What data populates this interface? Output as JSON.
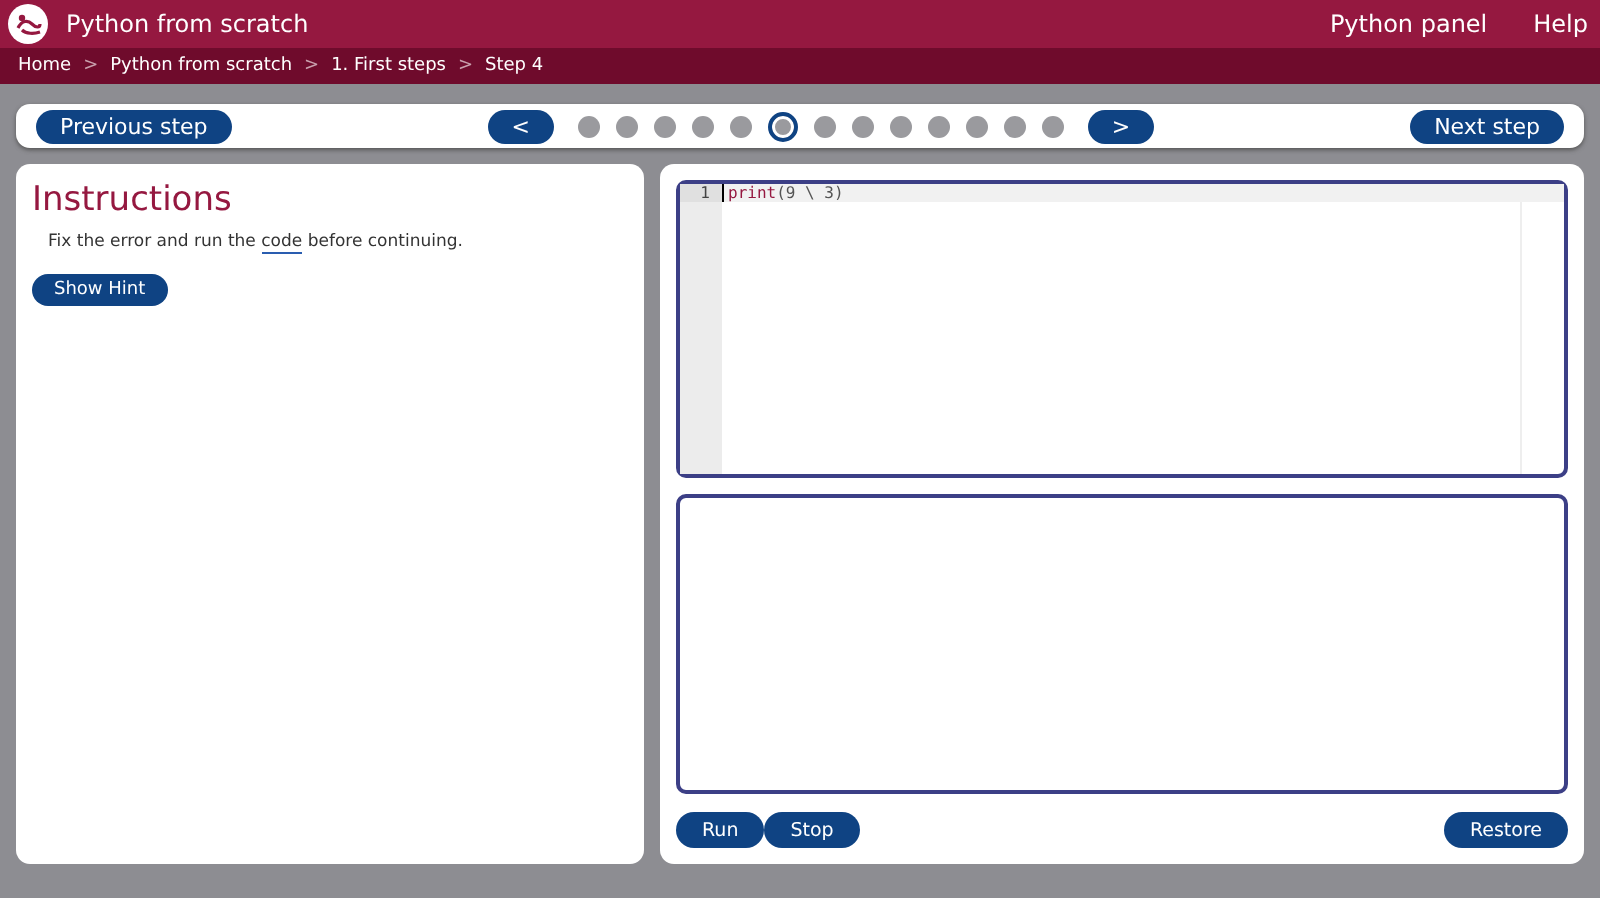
{
  "header": {
    "title": "Python from scratch",
    "menu": [
      "Python panel",
      "Help"
    ]
  },
  "breadcrumbs": [
    "Home",
    "Python from scratch",
    "1. First steps",
    "Step 4"
  ],
  "breadcrumb_separator": ">",
  "stepper": {
    "previous": "Previous step",
    "prev_arrow": "<",
    "next_arrow": ">",
    "next": "Next step",
    "steps": [
      {
        "selected": false
      },
      {
        "selected": false
      },
      {
        "selected": false
      },
      {
        "selected": false
      },
      {
        "selected": false
      },
      {
        "selected": true
      },
      {
        "selected": false
      },
      {
        "selected": false
      },
      {
        "selected": false
      },
      {
        "selected": false
      },
      {
        "selected": false
      },
      {
        "selected": false
      },
      {
        "selected": false
      }
    ]
  },
  "instructions": {
    "title": "Instructions",
    "text_before": "Fix the error and run the ",
    "link": "code",
    "text_after": " before continuing.",
    "hint_button": "Show Hint"
  },
  "editor": {
    "lines": [
      {
        "number": "1",
        "tokens": [
          {
            "kind": "keyword",
            "text": "print"
          },
          {
            "kind": "plain",
            "text": "(9 \\ 3)"
          }
        ]
      }
    ]
  },
  "buttons": {
    "run": "Run",
    "stop": "Stop",
    "restore": "Restore"
  }
}
